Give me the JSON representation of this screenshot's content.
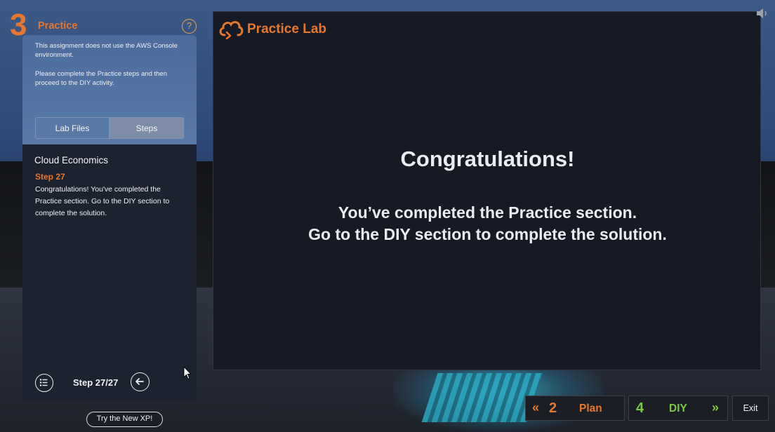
{
  "header": {
    "phase_number": "3",
    "phase_name": "Practice",
    "help_symbol": "?"
  },
  "left_panel": {
    "info_line1": "This assignment does not use the AWS Console environment.",
    "info_line2": "Please complete the Practice steps and then proceed to the DIY activity.",
    "tabs": [
      {
        "label": "Lab Files",
        "active": false
      },
      {
        "label": "Steps",
        "active": true
      }
    ],
    "section_title": "Cloud Economics",
    "step_label": "Step 27",
    "step_text": "Congratulations! You've completed the Practice section. Go to the DIY section to complete the solution.",
    "step_counter": "Step 27/27"
  },
  "lab": {
    "title": "Practice Lab",
    "heading": "Congratulations!",
    "message_line1": "You’ve completed the Practice section.",
    "message_line2": "Go to the DIY section to complete the solution."
  },
  "nav": {
    "prev_number": "2",
    "prev_label": "Plan",
    "next_number": "4",
    "next_label": "DIY",
    "exit_label": "Exit",
    "prev_chevron": "«",
    "next_chevron": "»"
  },
  "footer": {
    "new_xp_label": "Try the New XP!"
  },
  "colors": {
    "accent_orange": "#e8772e",
    "accent_green": "#7ac943",
    "panel_blue": "#5a7ba8",
    "lab_bg": "#151a24"
  }
}
